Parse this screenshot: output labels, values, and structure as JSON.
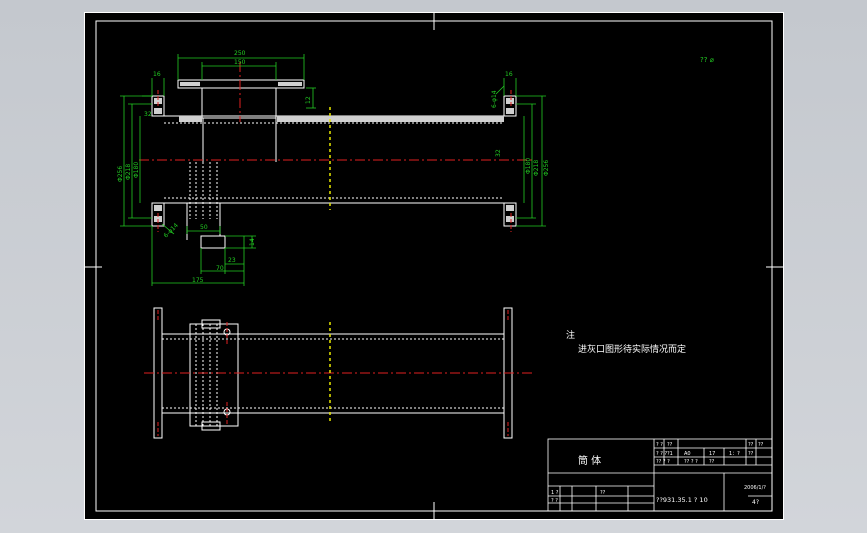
{
  "drawing": {
    "dims_top": {
      "flange_outer_width": "250",
      "flange_inner_width": "150",
      "flange_thickness_left": "16",
      "flange_thickness_right": "16",
      "flange_gap": "12",
      "hole_spec_left": "6-φ14",
      "hole_spec_right": "6-φ14",
      "left_d1": "Φ256",
      "left_d2": "Φ218",
      "left_d3": "Φ180",
      "right_d1": "Φ256",
      "right_d2": "Φ218",
      "right_d3": "Φ180",
      "left_small": "32",
      "right_small": "32",
      "opening_width": "50",
      "slot_height": "14",
      "dim_23": "23",
      "dim_70": "70",
      "dim_175": "175"
    },
    "roughness": "?? ⌀",
    "note_title": "注",
    "note_text": "进灰口图形待实际情况而定",
    "title_block": {
      "part_name": "筒  体",
      "code": "??931.35.1 ? 10",
      "date": "2006/1/?",
      "cell_a": "? ?",
      "cell_b": "??",
      "cell_c": "? ? ?",
      "cell_d": "?1",
      "cell_e": "A0",
      "cell_f": "17",
      "cell_g": "1：?",
      "cell_h": "?? ? ?",
      "cell_i": "?? ? ?",
      "cell_j": "??",
      "cell_k": "??",
      "cell_l": "??",
      "cell_m": "??",
      "cell_n": "1 ?",
      "cell_o": "? ?",
      "cell_p": "??",
      "sheet_no": "4?"
    }
  }
}
